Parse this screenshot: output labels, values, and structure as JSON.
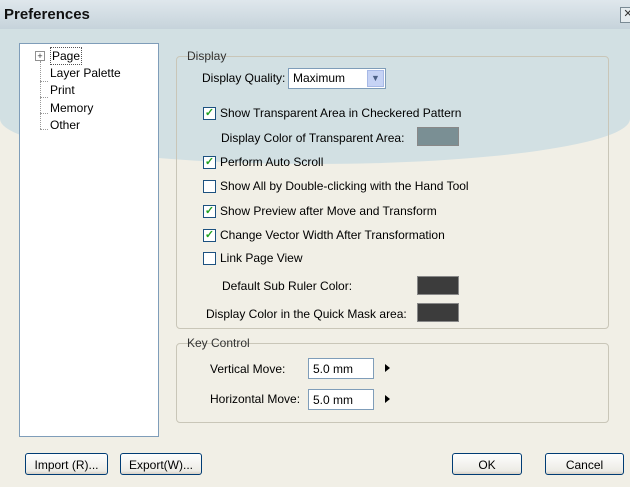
{
  "window": {
    "title": "Preferences"
  },
  "tree": {
    "items": [
      "Page",
      "Layer Palette",
      "Print",
      "Memory",
      "Other"
    ]
  },
  "display": {
    "legend": "Display",
    "quality_label": "Display Quality:",
    "quality_value": "Maximum",
    "show_transparent_label": "Show Transparent Area in Checkered Pattern",
    "transparent_color_label": "Display Color of Transparent Area:",
    "transparent_color": "#7a8f94",
    "auto_scroll_label": "Perform Auto Scroll",
    "show_all_label": "Show All by Double-clicking with the Hand Tool",
    "show_preview_label": "Show Preview after Move and Transform",
    "vector_width_label": "Change Vector Width After Transformation",
    "link_view_label": "Link Page View",
    "sub_ruler_label": "Default Sub Ruler Color:",
    "sub_ruler_color": "#3c3c3c",
    "quick_mask_label": "Display Color in the Quick Mask area:",
    "quick_mask_color": "#3c3c3c",
    "checked": {
      "show_transparent": true,
      "auto_scroll": true,
      "show_all": false,
      "show_preview": true,
      "vector_width": true,
      "link_view": false
    }
  },
  "key_control": {
    "legend": "Key Control",
    "vertical_label": "Vertical Move:",
    "vertical_value": "5.0 mm",
    "horizontal_label": "Horizontal Move:",
    "horizontal_value": "5.0 mm"
  },
  "buttons": {
    "import": "Import (R)...",
    "export": "Export(W)...",
    "ok": "OK",
    "cancel": "Cancel"
  }
}
